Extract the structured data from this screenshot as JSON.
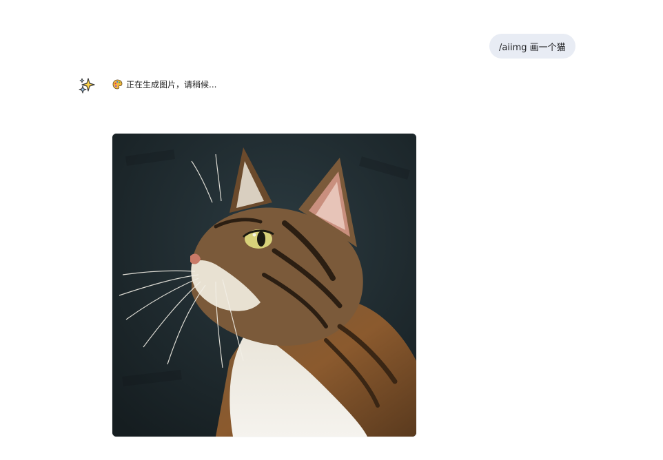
{
  "conversation": {
    "user_message": "/aiimg 画一个猫",
    "assistant": {
      "avatar_icon": "sparkles-icon",
      "status_icon": "artist-palette-icon",
      "status_text": "正在生成图片，请稍候..."
    },
    "generated_image": {
      "subject": "tabby-cat-painting-icon"
    }
  },
  "colors": {
    "user_bubble": "#e8ecf4",
    "background": "#ffffff",
    "image_bg": "#1f2a2e"
  }
}
